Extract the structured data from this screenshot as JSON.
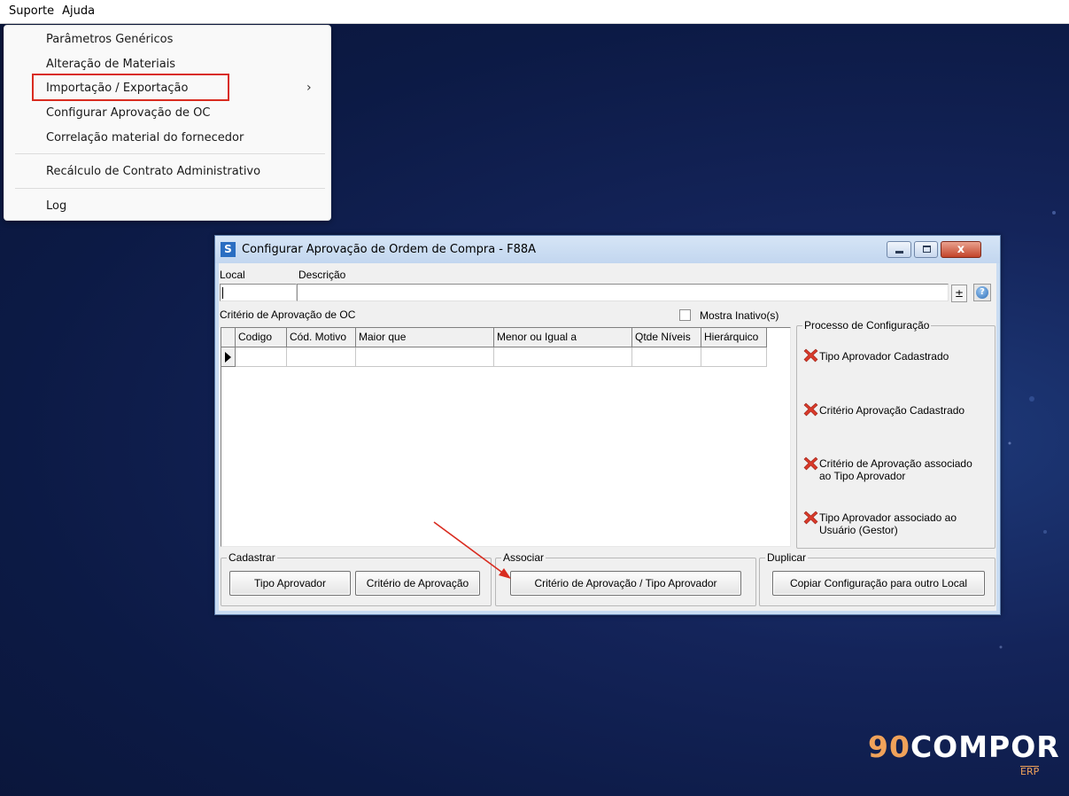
{
  "menubar": {
    "items": [
      "Suporte",
      "Ajuda"
    ]
  },
  "dropdown": {
    "items": [
      "Parâmetros Genéricos",
      "Alteração de Materiais",
      "Importação / Exportação",
      "Configurar Aprovação de OC",
      "Correlação material do fornecedor",
      "Recálculo de Contrato Administrativo",
      "Log"
    ],
    "submenu_arrow": "›",
    "highlighted": "Configurar Aprovação de OC"
  },
  "window": {
    "icon_letter": "S",
    "title": "Configurar Aprovação de Ordem de Compra - F88A",
    "close_glyph": "x",
    "local_label": "Local",
    "local_value": "",
    "descricao_label": "Descrição",
    "descricao_value": "",
    "lookup_glyph": "±",
    "help_glyph": "?",
    "grid_title": "Critério de Aprovação de OC",
    "mostra_inativo_label": "Mostra Inativo(s)",
    "mostra_inativo_checked": false,
    "grid_columns": [
      "Codigo",
      "Cód. Motivo",
      "Maior que",
      "Menor ou Igual a",
      "Qtde Níveis",
      "Hierárquico"
    ],
    "processo": {
      "title": "Processo de Configuração",
      "items": [
        [
          "Tipo Aprovador Cadastrado"
        ],
        [
          "Critério Aprovação Cadastrado"
        ],
        [
          "Critério de Aprovação associado",
          "ao Tipo Aprovador"
        ],
        [
          "Tipo Aprovador associado ao",
          "Usuário (Gestor)"
        ]
      ]
    },
    "cadastrar": {
      "title": "Cadastrar",
      "buttons": [
        "Tipo Aprovador",
        "Critério de Aprovação"
      ]
    },
    "associar": {
      "title": "Associar",
      "button": "Critério de Aprovação / Tipo Aprovador"
    },
    "duplicar": {
      "title": "Duplicar",
      "button": "Copiar Configuração para outro Local"
    }
  },
  "logo": {
    "number": "90",
    "word": "COMPOR",
    "suffix": "ERP"
  },
  "colors": {
    "highlight_border": "#d92c20",
    "status_icon": "#d93a2b",
    "logo_accent": "#f0a25a",
    "background": "#0c1a45"
  },
  "icons": {
    "status": "red-x-icon",
    "submenu": "chevron-right-icon",
    "help": "help-icon",
    "lookup": "dropdown-lookup-icon",
    "row_indicator": "row-pointer-icon"
  }
}
